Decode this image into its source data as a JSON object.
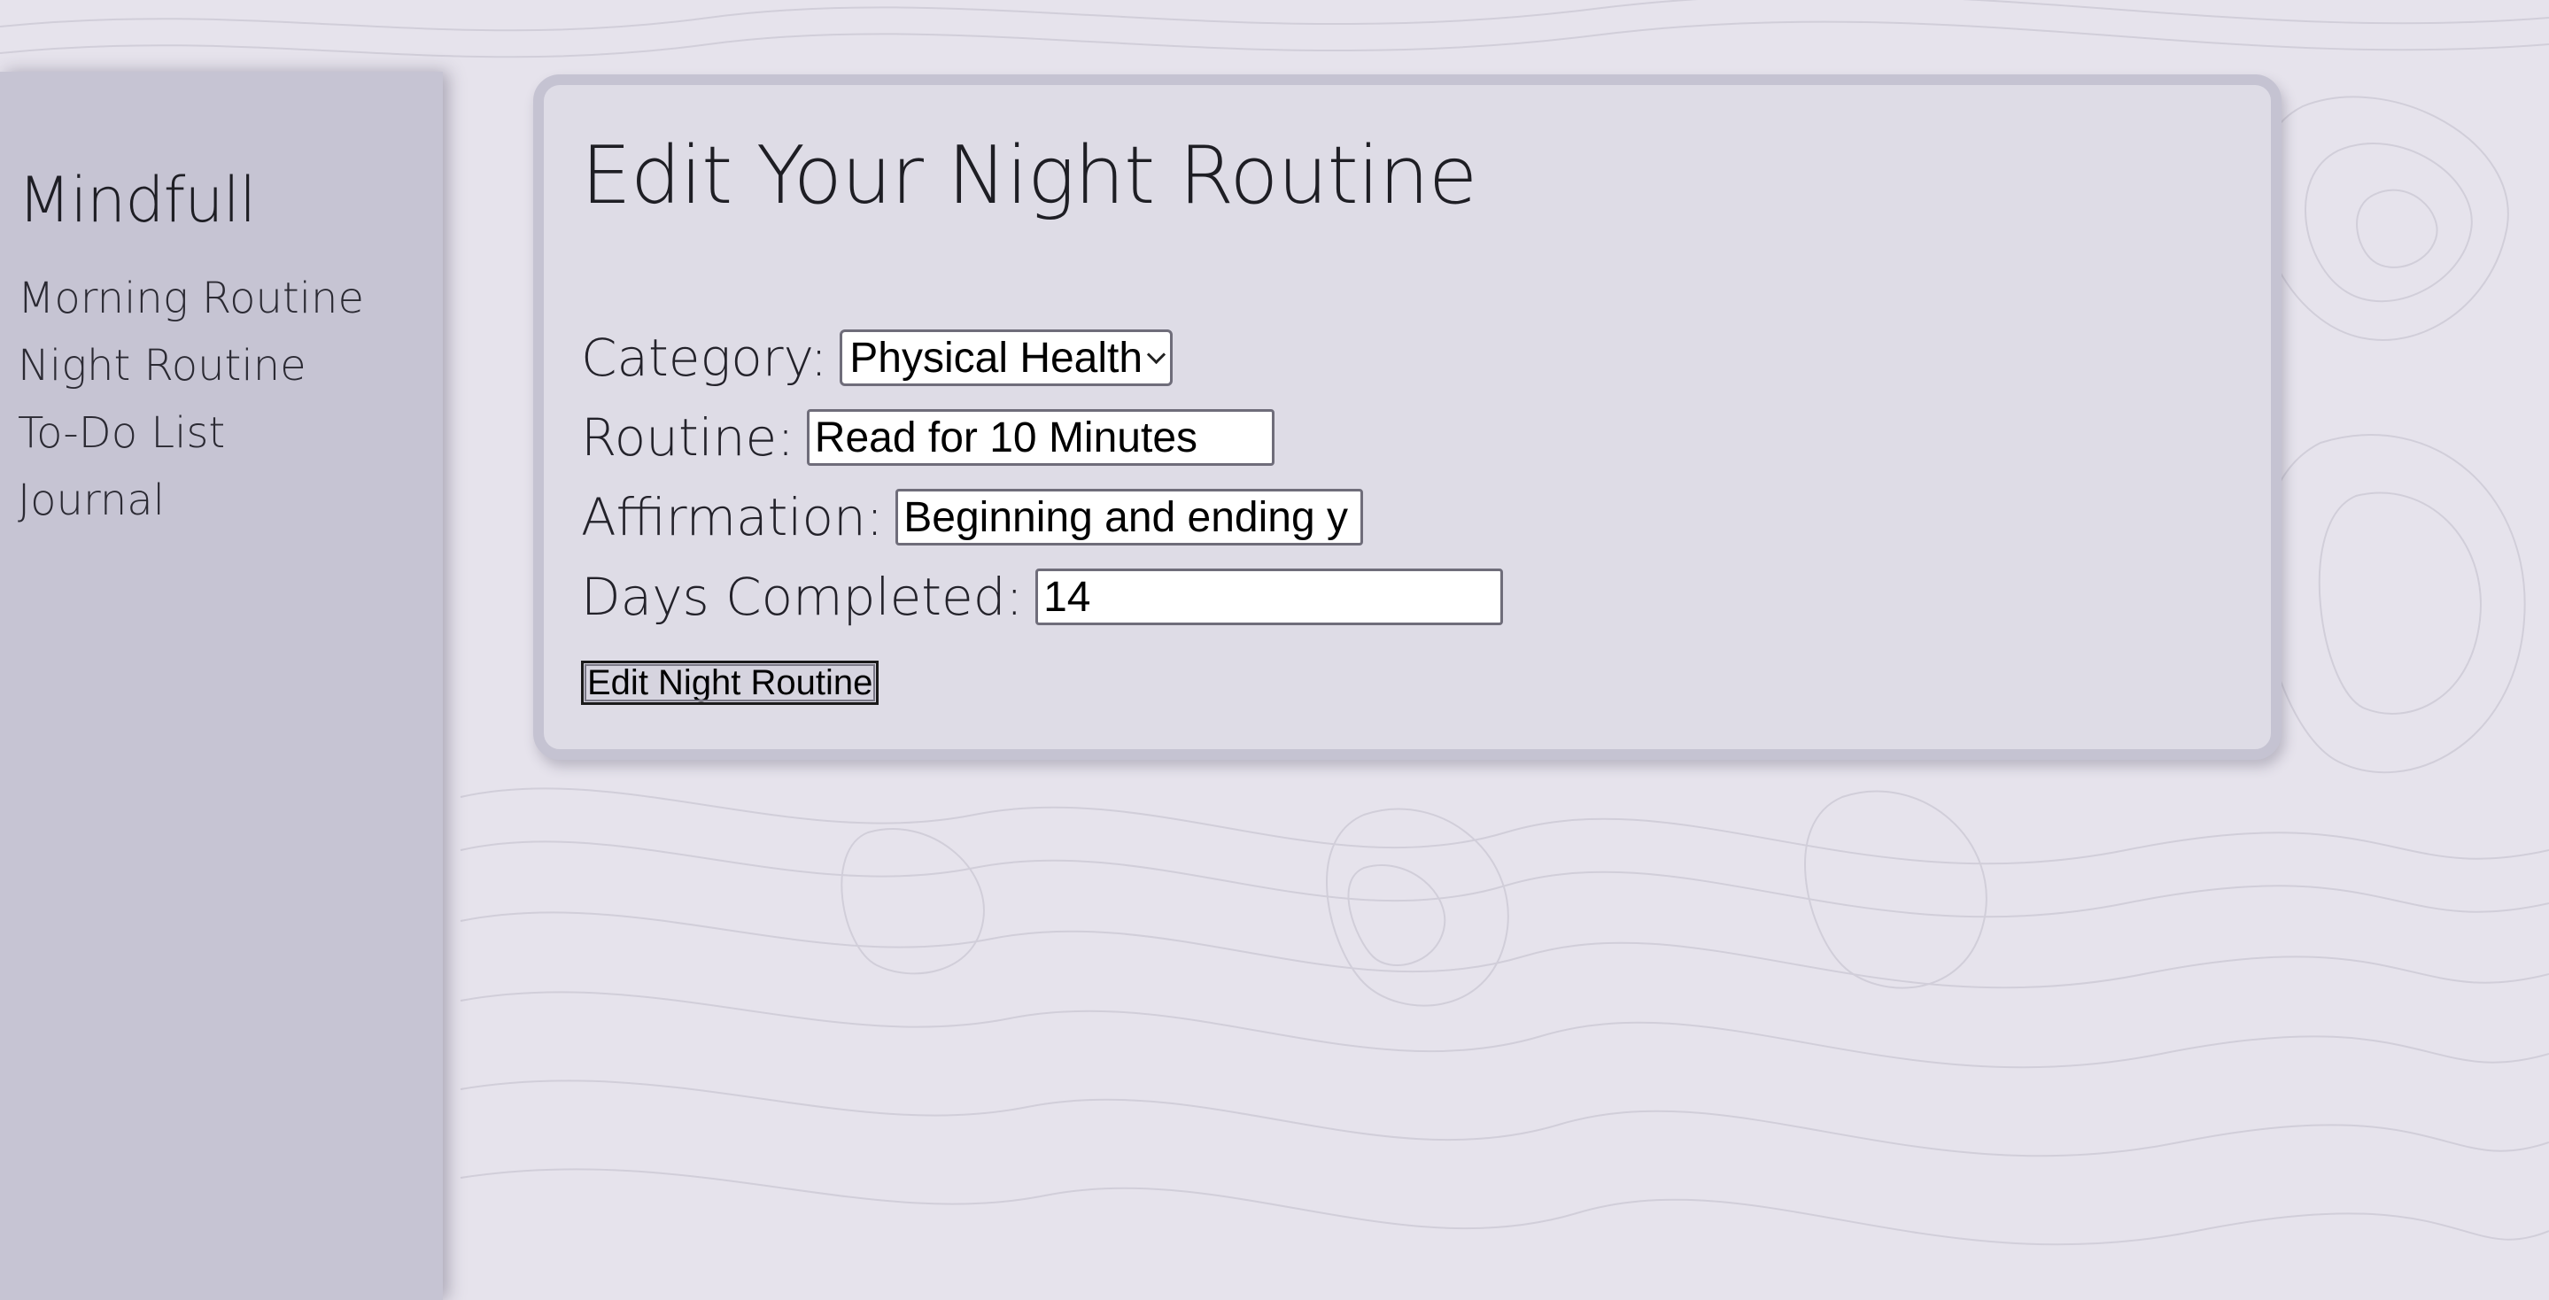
{
  "app": {
    "brand": "Mindfull"
  },
  "sidebar": {
    "items": [
      {
        "label": "Morning Routine"
      },
      {
        "label": "Night Routine"
      },
      {
        "label": "To-Do List"
      },
      {
        "label": "Journal"
      }
    ]
  },
  "form": {
    "title": "Edit Your Night Routine",
    "category": {
      "label": "Category:",
      "value": "Physical Health"
    },
    "routine": {
      "label": "Routine:",
      "value": "Read for 10 Minutes"
    },
    "affirmation": {
      "label": "Affirmation:",
      "value": "Beginning and ending y"
    },
    "days_completed": {
      "label": "Days Completed:",
      "value": "14"
    },
    "submit_label": "Edit Night Routine"
  },
  "colors": {
    "background": "#e6e3ec",
    "sidebar": "#c6c4d3",
    "card": "#dedce6",
    "card_border": "#c5c3d2"
  }
}
